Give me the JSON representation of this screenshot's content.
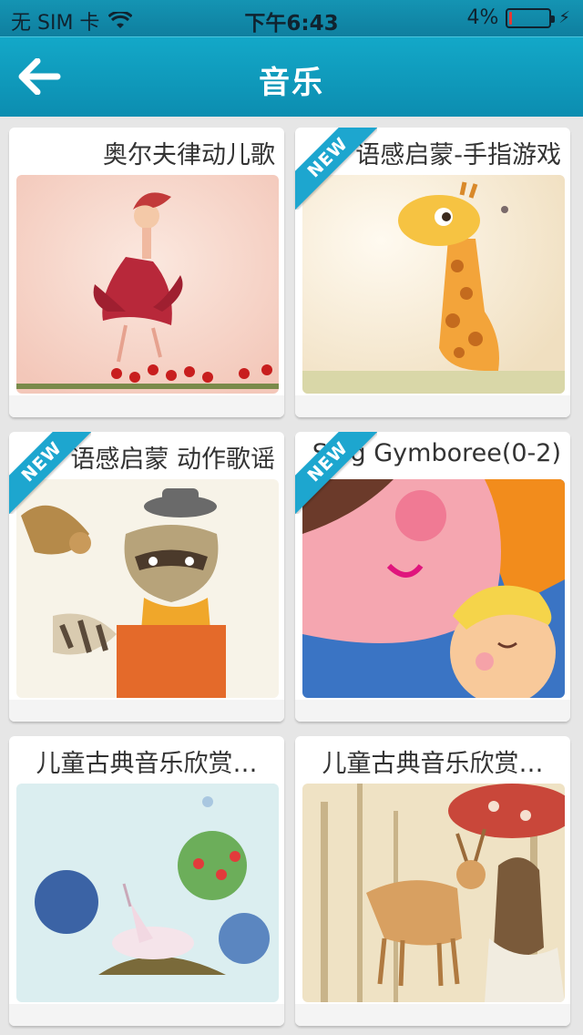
{
  "status": {
    "carrier": "无 SIM 卡",
    "time": "下午6:43",
    "battery_text": "4%",
    "battery_level": 0.04
  },
  "nav": {
    "title": "音乐"
  },
  "badge_label": "NEW",
  "cards": [
    {
      "title": "奥尔夫律动儿歌",
      "new": false
    },
    {
      "title": "语感启蒙-手指游戏",
      "new": true
    },
    {
      "title": "语感启蒙 动作歌谣",
      "new": true
    },
    {
      "title": "Sing Gymboree(0-2)",
      "new": true
    },
    {
      "title": "儿童古典音乐欣赏…",
      "new": false
    },
    {
      "title": "儿童古典音乐欣赏…",
      "new": false
    }
  ],
  "colors": {
    "nav_bg": "#0c8db0",
    "badge": "#1da6cf",
    "battery_low": "#e53935"
  }
}
